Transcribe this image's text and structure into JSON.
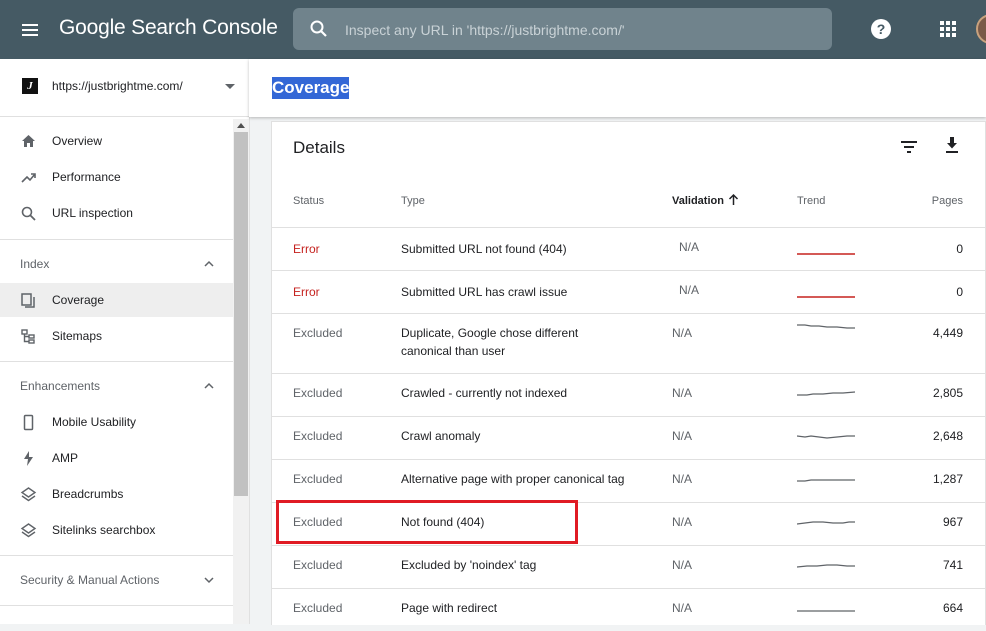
{
  "app": {
    "title": "Google Search Console",
    "search_placeholder": "Inspect any URL in 'https://justbrightme.com/'"
  },
  "icons": {
    "menu": "menu-icon",
    "search": "search-icon",
    "help": "help-icon",
    "apps": "apps-grid-icon"
  },
  "property": {
    "url": "https://justbrightme.com/",
    "favicon_letter": "J"
  },
  "sidebar": {
    "top_items": [
      {
        "label": "Overview",
        "icon": "home-icon"
      },
      {
        "label": "Performance",
        "icon": "trending-up-icon"
      },
      {
        "label": "URL inspection",
        "icon": "search-icon"
      }
    ],
    "index_section": "Index",
    "index_items": [
      {
        "label": "Coverage",
        "icon": "coverage-icon",
        "active": true
      },
      {
        "label": "Sitemaps",
        "icon": "sitemap-icon"
      }
    ],
    "enhancements_section": "Enhancements",
    "enhancement_items": [
      {
        "label": "Mobile Usability",
        "icon": "phone-icon"
      },
      {
        "label": "AMP",
        "icon": "bolt-icon"
      },
      {
        "label": "Breadcrumbs",
        "icon": "layers-icon"
      },
      {
        "label": "Sitelinks searchbox",
        "icon": "layers-icon"
      }
    ],
    "security_section": "Security & Manual Actions"
  },
  "page": {
    "title": "Coverage"
  },
  "details": {
    "title": "Details",
    "columns": {
      "status": "Status",
      "type": "Type",
      "validation": "Validation",
      "trend": "Trend",
      "pages": "Pages"
    },
    "rows": [
      {
        "status": "Error",
        "type": "Submitted URL not found (404)",
        "validation": "N/A",
        "pages": "0"
      },
      {
        "status": "Error",
        "type": "Submitted URL has crawl issue",
        "validation": "N/A",
        "pages": "0"
      },
      {
        "status": "Excluded",
        "type": "Duplicate, Google chose different canonical than user",
        "validation": "N/A",
        "pages": "4,449"
      },
      {
        "status": "Excluded",
        "type": "Crawled - currently not indexed",
        "validation": "N/A",
        "pages": "2,805"
      },
      {
        "status": "Excluded",
        "type": "Crawl anomaly",
        "validation": "N/A",
        "pages": "2,648"
      },
      {
        "status": "Excluded",
        "type": "Alternative page with proper canonical tag",
        "validation": "N/A",
        "pages": "1,287"
      },
      {
        "status": "Excluded",
        "type": "Not found (404)",
        "validation": "N/A",
        "pages": "967"
      },
      {
        "status": "Excluded",
        "type": "Excluded by 'noindex' tag",
        "validation": "N/A",
        "pages": "741"
      },
      {
        "status": "Excluded",
        "type": "Page with redirect",
        "validation": "N/A",
        "pages": "664"
      }
    ]
  },
  "colors": {
    "topbar": "#455a64",
    "error": "#c5221f",
    "highlight": "#e01b24",
    "selection": "#3367d6"
  }
}
